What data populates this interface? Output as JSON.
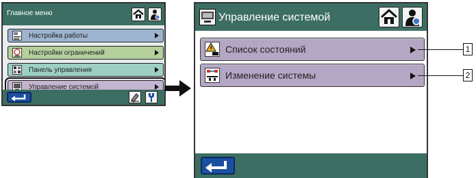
{
  "left_screen": {
    "title": "Главное меню",
    "menu_items": [
      {
        "label": "Настройка работы",
        "icon": "work-settings-icon",
        "color": "#9db4cf"
      },
      {
        "label": "Настройки ограничений",
        "icon": "limits-settings-icon",
        "color": "#b5cf9d"
      },
      {
        "label": "Панель управления",
        "icon": "control-panel-icon",
        "color": "#9dcfc2"
      },
      {
        "label": "Управление системой",
        "icon": "system-management-icon",
        "color": "#c3b4cf",
        "selected": true
      }
    ]
  },
  "right_screen": {
    "title": "Управление системой",
    "items": [
      {
        "label": "Список состояний",
        "icon": "warning-status-icon",
        "callout": "1"
      },
      {
        "label": "Изменение системы",
        "icon": "system-change-icon",
        "callout": "2"
      }
    ]
  },
  "colors": {
    "bar": "#3d6e63",
    "back_button": "#1b4fa0",
    "selected_row": "#b4a7c4"
  }
}
